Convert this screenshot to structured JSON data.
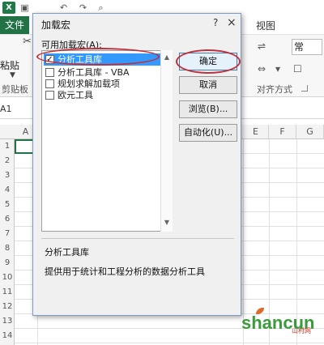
{
  "excel": {
    "logo_letter": "X",
    "file_tab": "文件",
    "view_tab": "视图",
    "paste_label": "粘贴",
    "clipboard_group": "剪贴板",
    "alignment_group": "对齐方式",
    "number_format": "常",
    "name_box": "A1",
    "columns": [
      "A",
      "E",
      "F",
      "G"
    ],
    "rows": [
      "1",
      "2",
      "3",
      "4",
      "5",
      "6",
      "7",
      "8",
      "9",
      "10",
      "11",
      "12",
      "13",
      "14"
    ]
  },
  "dialog": {
    "title": "加载宏",
    "help": "?",
    "close": "×",
    "list_label": "可用加载宏(A):",
    "addins": [
      {
        "label": "分析工具库",
        "checked": true,
        "selected": true
      },
      {
        "label": "分析工具库 - VBA",
        "checked": false,
        "selected": false
      },
      {
        "label": "规划求解加载项",
        "checked": false,
        "selected": false
      },
      {
        "label": "欧元工具",
        "checked": false,
        "selected": false
      }
    ],
    "buttons": {
      "ok": "确定",
      "cancel": "取消",
      "browse": "浏览(B)...",
      "automation": "自动化(U)..."
    },
    "description_title": "分析工具库",
    "description_text": "提供用于统计和工程分析的数据分析工具"
  },
  "watermark": {
    "text": "shancun",
    "sub": "山村网"
  },
  "colors": {
    "excel_green": "#217346",
    "selection_blue": "#3399ff",
    "highlight_red": "#c0303a"
  }
}
